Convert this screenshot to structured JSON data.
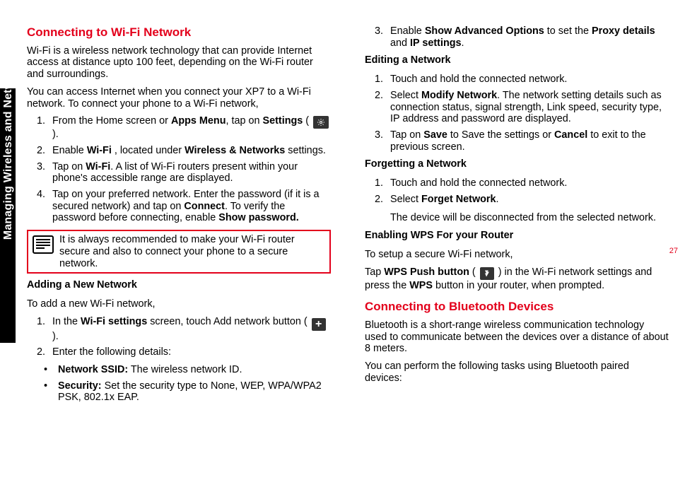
{
  "sidebar": {
    "label": "Managing Wireless and Network Settings"
  },
  "page_number": "27",
  "left": {
    "h1": "Connecting to Wi-Fi Network",
    "p1": "Wi-Fi is a wireless network technology that can provide Internet access at distance upto 100 feet, depending on the Wi-Fi router and surroundings.",
    "p2": "You can access Internet when you connect your XP7 to a Wi-Fi network. To connect your phone to a Wi-Fi network,",
    "l1a": "From the Home screen or ",
    "l1b": "Apps Menu",
    "l1c": ", tap on ",
    "l1d": "Settings",
    "l1e": " ( ",
    "l1f": " ).",
    "l2a": "Enable ",
    "l2b": "Wi-Fi ",
    "l2c": ", located under ",
    "l2d": "Wireless & Networks",
    "l2e": " settings.",
    "l3a": "Tap on ",
    "l3b": "Wi-Fi",
    "l3c": ". A list of Wi-Fi routers present within your phone's accessible range are displayed.",
    "l4a": "Tap on your preferred network. Enter the password (if it is a secured network) and tap on ",
    "l4b": "Connect",
    "l4c": ". To verify the password before connecting, enable ",
    "l4d": "Show password.",
    "note": "It is always recommended to make your Wi-Fi router secure and also to connect your phone to a secure network.",
    "h2": "Adding a New Network",
    "p3": "To add a new Wi-Fi network,",
    "a1a": "In the ",
    "a1b": "Wi-Fi settings",
    "a1c": " screen, touch Add network button ( ",
    "a1d": " ).",
    "a2": "Enter the following details:",
    "b1a": "Network SSID:",
    "b1b": " The wireless network ID.",
    "b2a": "Security:",
    "b2b": " Set the security type to None, WEP, WPA/WPA2 PSK, 802.1x EAP."
  },
  "right": {
    "r1a": "Enable ",
    "r1b": "Show Advanced Options",
    "r1c": " to set the ",
    "r1d": "Proxy details",
    "r1e": " and ",
    "r1f": "IP settings",
    "r1g": ".",
    "h3": "Editing a Network",
    "e1": "Touch and hold the connected network.",
    "e2a": "Select ",
    "e2b": "Modify Network",
    "e2c": ". The network setting details such as connection status, signal strength, Link speed, security type, IP address and password are displayed.",
    "e3a": "Tap on ",
    "e3b": "Save",
    "e3c": " to Save the settings or ",
    "e3d": "Cancel",
    "e3e": " to exit to the previous screen.",
    "h4": "Forgetting a Network",
    "f1": "Touch and hold the connected network.",
    "f2a": "Select ",
    "f2b": "Forget Network",
    "f2c": ".",
    "f_p": "The device will be disconnected from the selected network.",
    "h5": "Enabling WPS For your Router",
    "w1": "To setup a secure Wi-Fi network,",
    "w2a": "Tap ",
    "w2b": "WPS Push button",
    "w2c": " ( ",
    "w2d": " ) in the Wi-Fi network settings and press the ",
    "w2e": "WPS",
    "w2f": " button in your router, when prompted.",
    "h6": "Connecting to Bluetooth Devices",
    "bt1": "Bluetooth is a short-range wireless communication technology used to communicate between the devices over a distance of about 8 meters.",
    "bt2": "You can perform the following tasks using Bluetooth paired devices:"
  }
}
